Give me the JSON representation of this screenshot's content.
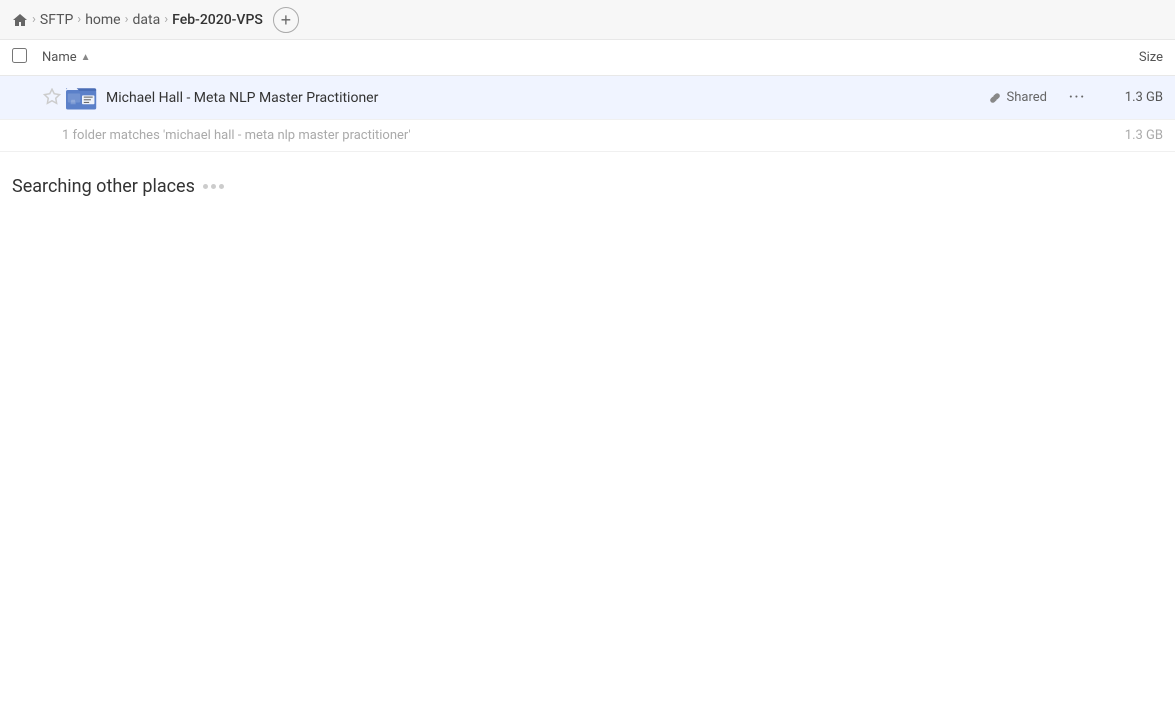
{
  "toolbar": {
    "home_label": "home icon",
    "breadcrumb": [
      {
        "label": "SFTP",
        "id": "sftp"
      },
      {
        "label": "home",
        "id": "home"
      },
      {
        "label": "data",
        "id": "data"
      },
      {
        "label": "Feb-2020-VPS",
        "id": "current"
      }
    ],
    "add_button_label": "+"
  },
  "columns": {
    "name_label": "Name",
    "sort_arrow": "▲",
    "size_label": "Size"
  },
  "file_row": {
    "name": "Michael Hall - Meta NLP Master Practitioner",
    "shared_label": "Shared",
    "size": "1.3 GB",
    "more_label": "···"
  },
  "match_info": {
    "text": "1 folder matches 'michael hall - meta nlp master practitioner'",
    "size": "1.3 GB"
  },
  "searching": {
    "title": "Searching other places"
  }
}
